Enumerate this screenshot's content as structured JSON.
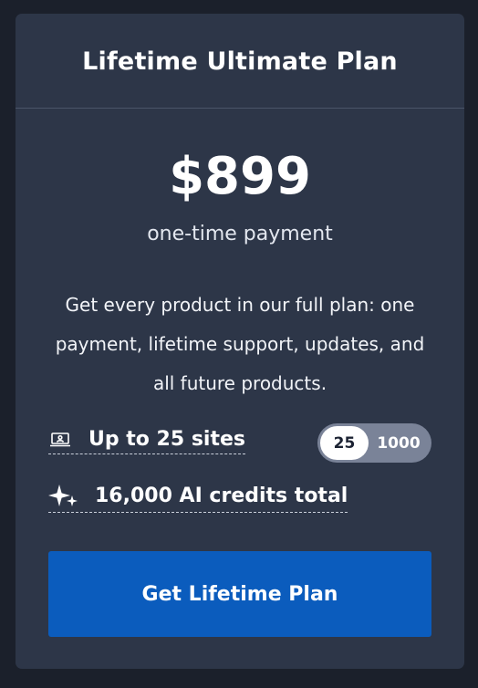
{
  "plan": {
    "title": "Lifetime Ultimate Plan",
    "price": "$899",
    "payment_type": "one-time payment",
    "description": "Get every product in our full plan: one payment, lifetime support, updates, and all future products."
  },
  "features": {
    "sites": {
      "icon": "laptop-icon",
      "label": "Up to 25 sites"
    },
    "credits": {
      "icon": "sparkle-icon",
      "label": "16,000 AI credits total"
    }
  },
  "site_toggle": {
    "options": [
      "25",
      "1000"
    ],
    "selected": "25"
  },
  "cta": {
    "label": "Get Lifetime Plan"
  },
  "colors": {
    "page_background": "#1b202b",
    "card_background": "#2d3648",
    "cta_background": "#0b5cbd",
    "toggle_background": "#7a8398"
  }
}
